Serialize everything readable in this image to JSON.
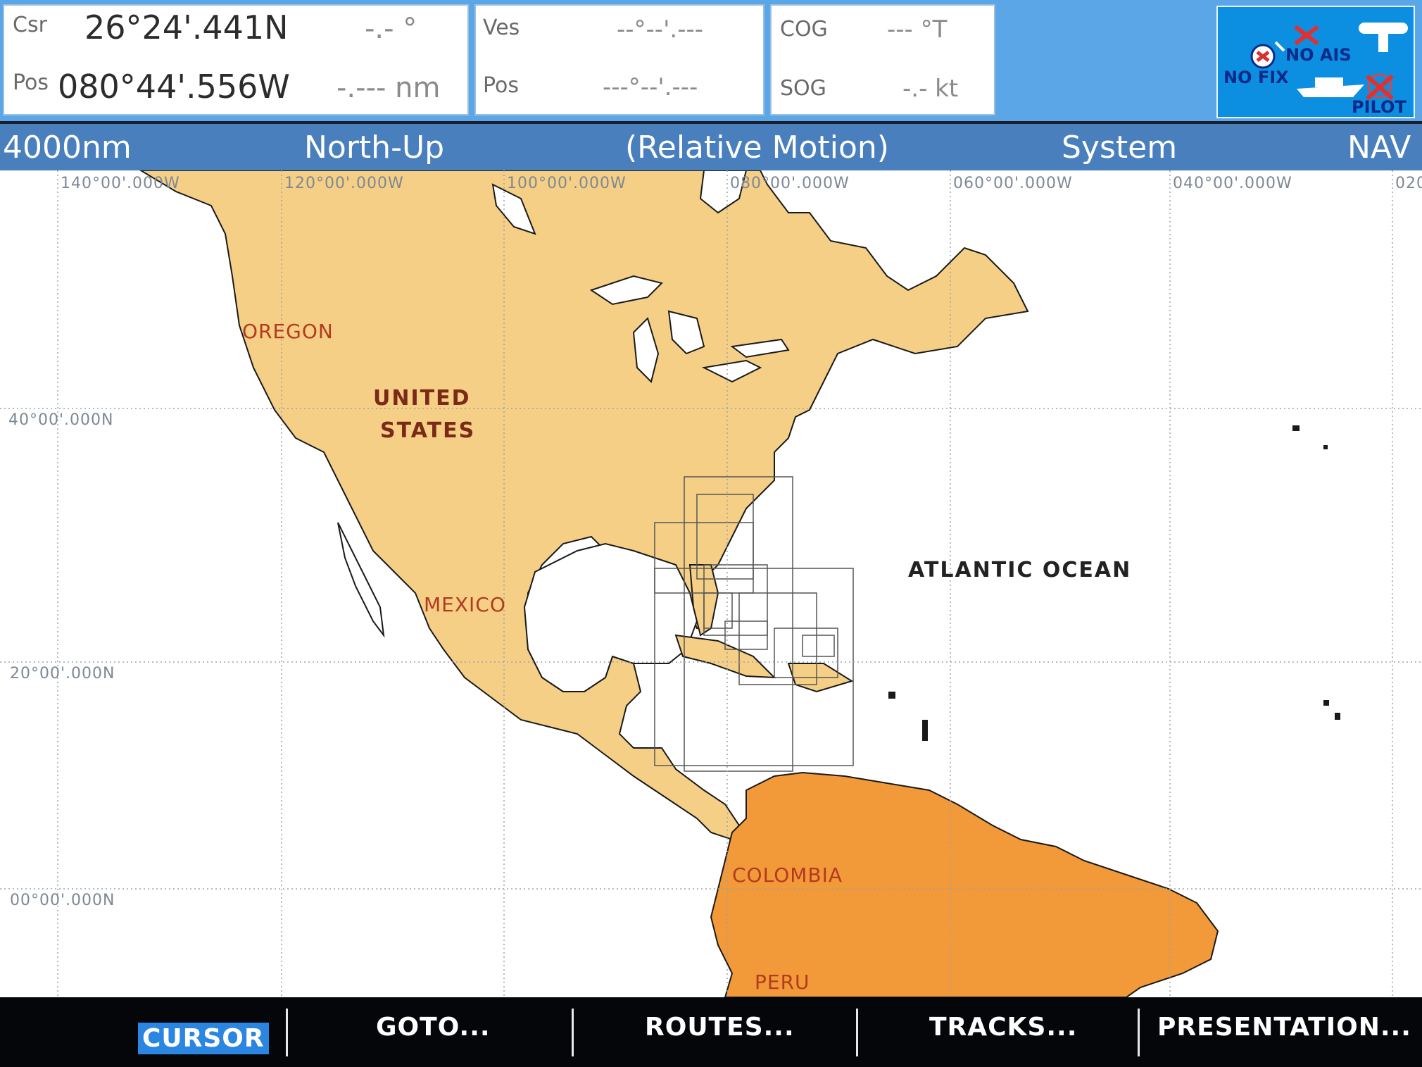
{
  "cursor_panel": {
    "csr_label": "Csr",
    "lat": "26°24'.441N",
    "brg": "-.- °",
    "pos_label": "Pos",
    "lon": "080°44'.556W",
    "range": "-.--- nm"
  },
  "vessel_panel": {
    "ves_label": "Ves",
    "ves_value": "--°--'.---",
    "pos_label": "Pos",
    "pos_value": "---°--'.---"
  },
  "course_panel": {
    "cog_label": "COG",
    "cog_value": "--- °T",
    "sog_label": "SOG",
    "sog_value": "-.- kt"
  },
  "status": {
    "no_ais": "NO AIS",
    "no_fix": "NO FIX",
    "pilot": "PILOT"
  },
  "titlebar": {
    "range": "4000nm",
    "orientation": "North-Up",
    "motion": "(Relative Motion)",
    "mode": "System",
    "page": "NAV"
  },
  "chart": {
    "longitude_labels": [
      "140°00'.000W",
      "120°00'.000W",
      "100°00'.000W",
      "080°00'.000W",
      "060°00'.000W",
      "040°00'.000W",
      "020"
    ],
    "latitude_labels": [
      "40°00'.000N",
      "20°00'.000N",
      "00°00'.000N"
    ],
    "places": {
      "oregon": "OREGON",
      "us_line1": "UNITED",
      "us_line2": "STATES",
      "mexico": "MEXICO",
      "atlantic": "ATLANTIC OCEAN",
      "colombia": "COLOMBIA",
      "peru": "PERU"
    },
    "colors": {
      "land_north": "#f5cf86",
      "land_south": "#f2993a",
      "water": "#ffffff",
      "grid": "#9aa3ad"
    }
  },
  "softkeys": {
    "cursor": "CURSOR",
    "goto": "GOTO...",
    "routes": "ROUTES...",
    "tracks": "TRACKS...",
    "presentation": "PRESENTATION..."
  }
}
